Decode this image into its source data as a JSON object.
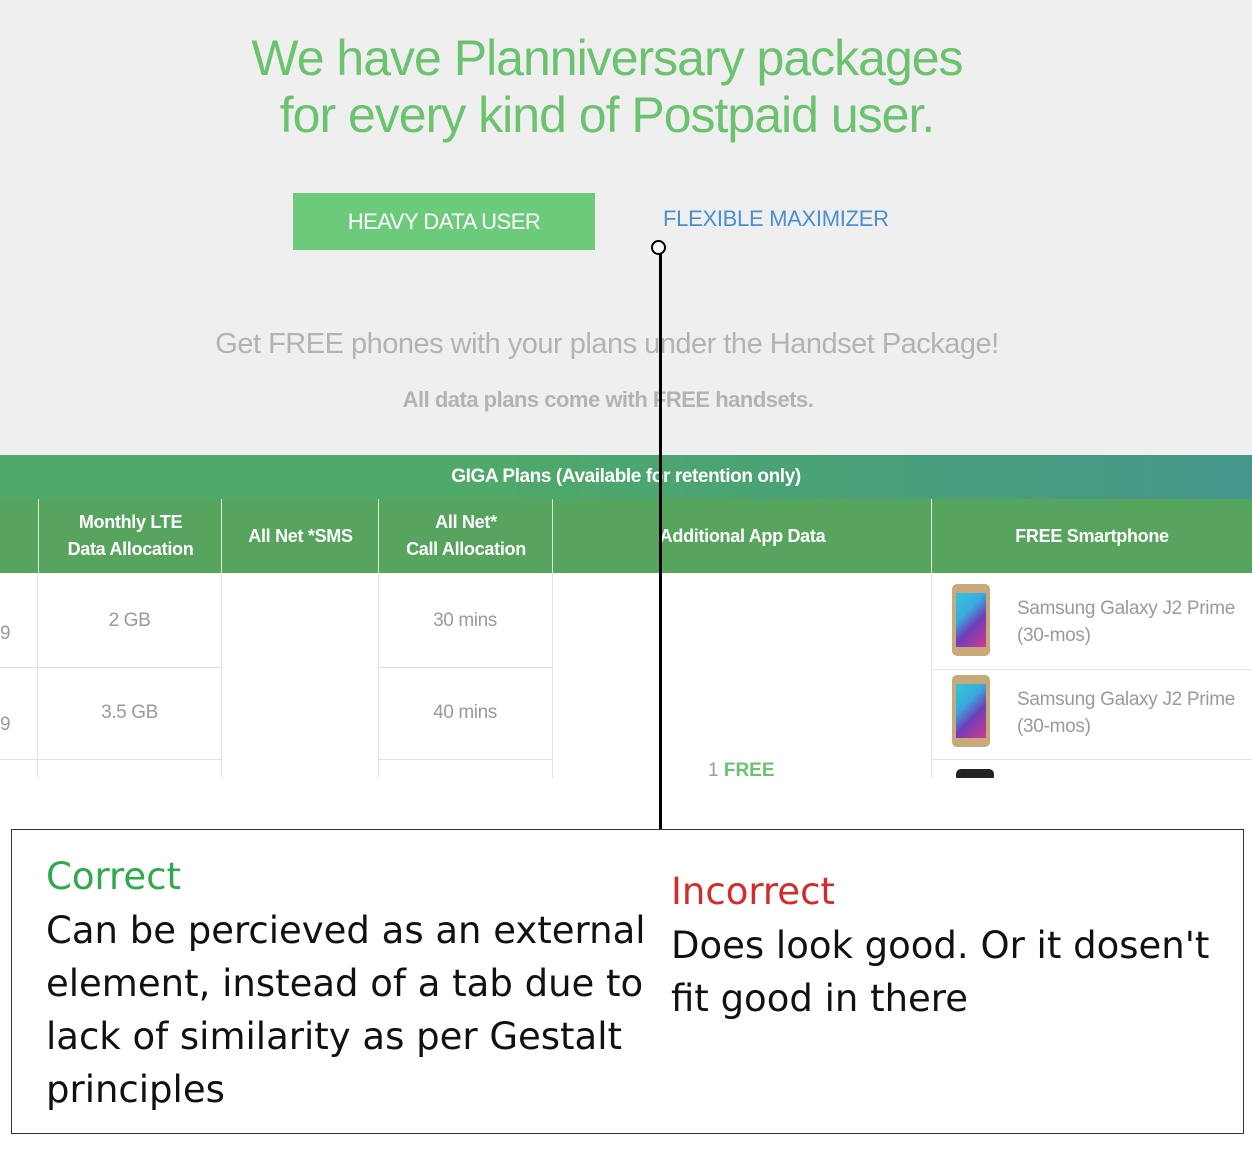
{
  "headline": {
    "line1": "We have Planniversary packages",
    "line2": "for every kind of Postpaid user."
  },
  "tabs": {
    "active_label": "HEAVY DATA USER",
    "inactive_label": "FLEXIBLE MAXIMIZER"
  },
  "promo": {
    "line1": "Get FREE phones with your plans under the Handset Package!",
    "line2": "All data plans come with FREE handsets."
  },
  "plan_table": {
    "title": "GIGA Plans (Available for retention only)",
    "headers": {
      "data_l1": "Monthly LTE",
      "data_l2": "Data Allocation",
      "sms": "All Net *SMS",
      "call_l1": "All Net*",
      "call_l2": "Call Allocation",
      "app": "Additional App Data",
      "phone": "FREE Smartphone"
    },
    "rows": [
      {
        "price_fragment": "9",
        "data": "2 GB",
        "calls": "30 mins",
        "phone_l1": "Samsung Galaxy J2 Prime",
        "phone_l2": "(30-mos)"
      },
      {
        "price_fragment": "9",
        "data": "3.5 GB",
        "calls": "40 mins",
        "phone_l1": "Samsung Galaxy J2 Prime",
        "phone_l2": "(30-mos)"
      }
    ],
    "app_data_num": "1",
    "app_data_free": "FREE"
  },
  "annotation": {
    "correct_label": "Correct",
    "correct_text": "Can be percieved as an external element, instead of a tab due to lack of similarity as per Gestalt principles",
    "incorrect_label": "Incorrect",
    "incorrect_text": "Does look good. Or it dosen't fit good in there"
  },
  "colors": {
    "brand_green": "#6cc36f",
    "tab_green": "#6ccb7b",
    "link_blue": "#4a8fd0",
    "header_green": "#56a45e",
    "correct_green": "#2fa84f",
    "incorrect_red": "#d62a2a"
  }
}
